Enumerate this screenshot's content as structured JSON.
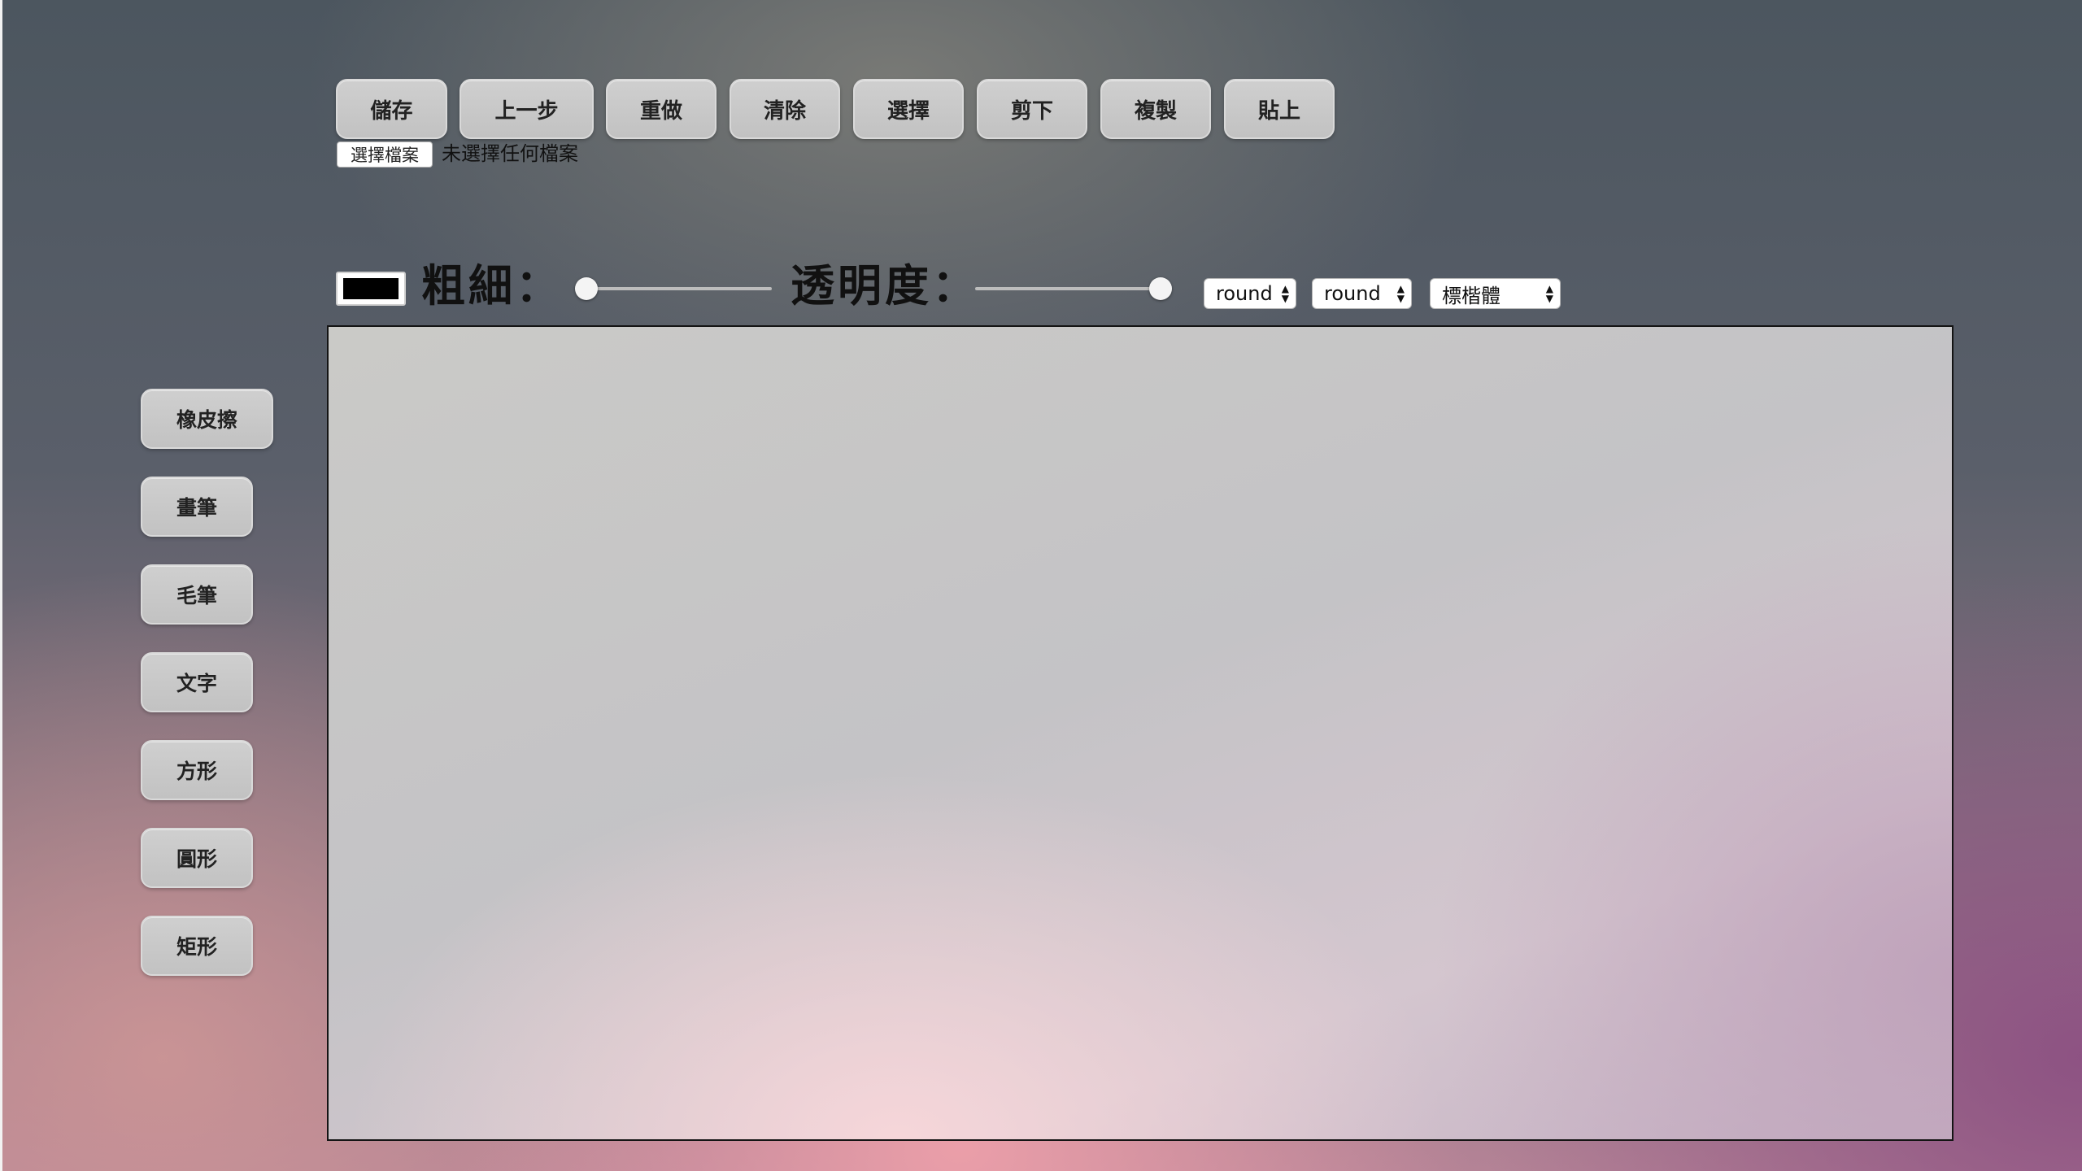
{
  "toolbar": {
    "save": "儲存",
    "undo": "上一步",
    "redo": "重做",
    "clear": "清除",
    "select": "選擇",
    "cut": "剪下",
    "copy": "複製",
    "paste": "貼上"
  },
  "file": {
    "button_label": "選擇檔案",
    "status": "未選擇任何檔案"
  },
  "controls": {
    "stroke_color": "#000000",
    "thickness_label": "粗細：",
    "thickness_level": 0,
    "opacity_label": "透明度：",
    "opacity_level": 1,
    "line_cap_value": "round",
    "line_join_value": "round",
    "font_value": "標楷體"
  },
  "tools": {
    "eraser": "橡皮擦",
    "pen": "畫筆",
    "brush": "毛筆",
    "text": "文字",
    "square": "方形",
    "circle": "圓形",
    "rectangle": "矩形"
  }
}
